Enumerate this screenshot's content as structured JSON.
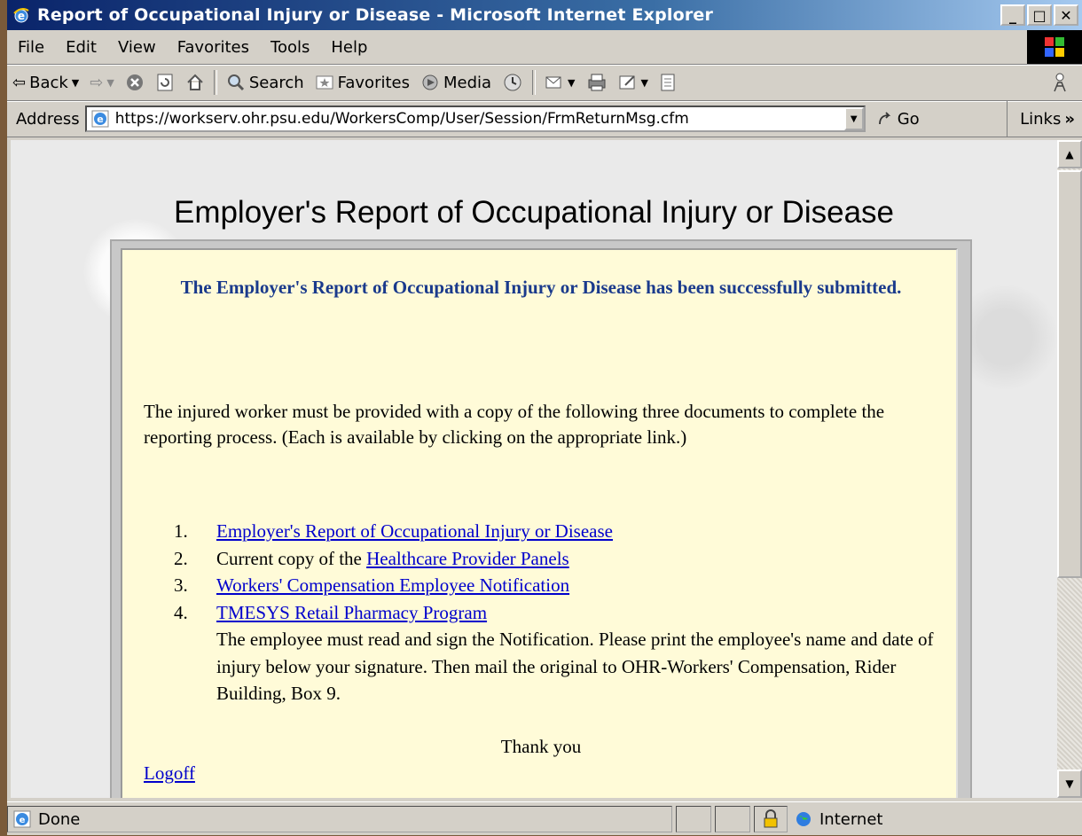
{
  "window": {
    "title": "Report of Occupational Injury or Disease - Microsoft Internet Explorer",
    "min_label": "_",
    "max_label": "□",
    "close_label": "✕"
  },
  "menu": {
    "items": [
      "File",
      "Edit",
      "View",
      "Favorites",
      "Tools",
      "Help"
    ]
  },
  "toolbar": {
    "back_label": "Back",
    "search_label": "Search",
    "favorites_label": "Favorites",
    "media_label": "Media"
  },
  "address": {
    "label": "Address",
    "url": "https://workserv.ohr.psu.edu/WorkersComp/User/Session/FrmReturnMsg.cfm",
    "go_label": "Go",
    "links_label": "Links",
    "links_chevron": "»"
  },
  "page": {
    "heading": "Employer's Report of Occupational Injury or Disease",
    "success_message": "The Employer's Report of Occupational Injury or Disease has been successfully submitted.",
    "intro": "The injured worker must be provided with a copy of the following three documents to complete the reporting process. (Each is available by clicking on the appropriate link.)",
    "documents": [
      {
        "num": "1.",
        "prefix": "",
        "link": "Employer's Report of Occupational Injury or Disease"
      },
      {
        "num": "2.",
        "prefix": "Current copy of the ",
        "link": "Healthcare Provider Panels"
      },
      {
        "num": "3.",
        "prefix": "",
        "link": "Workers' Compensation Employee Notification"
      },
      {
        "num": "4.",
        "prefix": "",
        "link": "TMESYS Retail Pharmacy Program"
      }
    ],
    "instruction": "The employee must read and sign the Notification. Please print the employee's name and date of injury below your signature. Then mail the original to OHR-Workers' Compensation, Rider Building, Box 9.",
    "thanks": "Thank you",
    "logoff": "Logoff"
  },
  "status": {
    "text": "Done",
    "zone": "Internet"
  }
}
